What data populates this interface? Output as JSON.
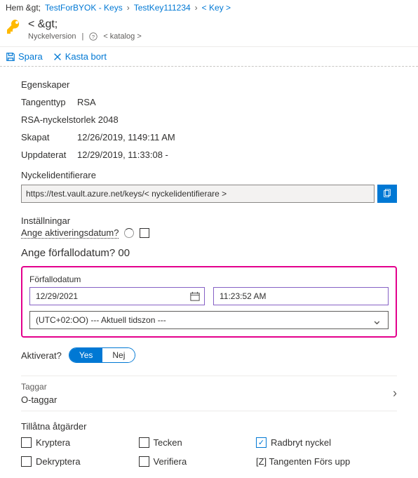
{
  "breadcrumb": {
    "home": "Hem &gt;",
    "item1": "TestForBYOK - Keys",
    "item2": "TestKey111234",
    "item3": "< Key >"
  },
  "header": {
    "title": "< &gt;",
    "subtitle": "Nyckelversion",
    "catalog": "< katalog >"
  },
  "toolbar": {
    "save": "Spara",
    "discard": "Kasta bort"
  },
  "props": {
    "section": "Egenskaper",
    "keytype_label": "Tangenttyp",
    "keytype_value": "RSA",
    "rsasize": "RSA-nyckelstorlek 2048",
    "created_label": "Skapat",
    "created_value": "12/26/2019, 1149:11 AM",
    "updated_label": "Uppdaterat",
    "updated_value": "12/29/2019, 11:33:08 -",
    "kid_label": "Nyckelidentifierare",
    "kid_value": "https://test.vault.azure.net/keys/< nyckelidentifierare >"
  },
  "settings": {
    "title": "Inställningar",
    "activation": "Ange aktiveringsdatum?",
    "expire_q": "Ange förfallodatum? 00",
    "exp_label": "Förfallodatum",
    "date_value": "12/29/2021",
    "time_value": "11:23:52 AM",
    "tz_value": "(UTC+02:OO) --- Aktuell tidszon       ---",
    "enabled_label": "Aktiverat?",
    "yes": "Yes",
    "no": "Nej"
  },
  "tags": {
    "title": "Taggar",
    "value": "O-taggar"
  },
  "ops": {
    "title": "Tillåtna åtgärder",
    "encrypt": "Kryptera",
    "sign": "Tecken",
    "wrap": "Radbryt nyckel",
    "decrypt": "Dekryptera",
    "verify": "Verifiera",
    "unwrap": "[Z] Tangenten Förs upp"
  }
}
